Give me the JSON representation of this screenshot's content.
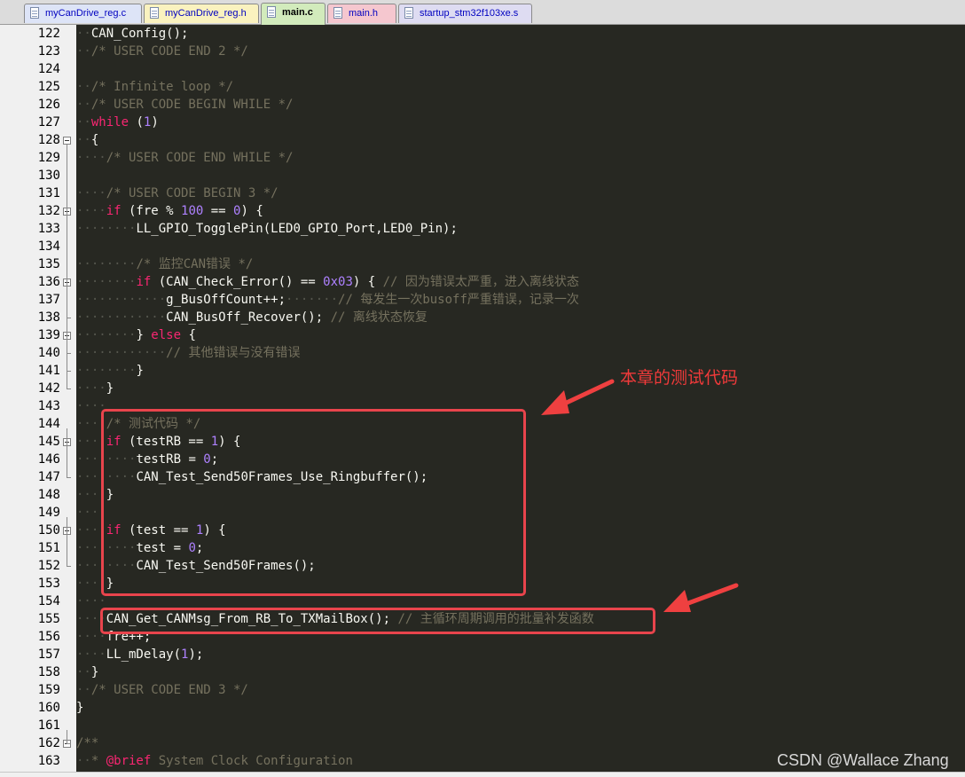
{
  "tabs": [
    {
      "label": "myCanDrive_reg.c",
      "color": "#dde4f7",
      "active": false
    },
    {
      "label": "myCanDrive_reg.h",
      "color": "#faf2bf",
      "active": false
    },
    {
      "label": "main.c",
      "color": "#d2ebbc",
      "active": true
    },
    {
      "label": "main.h",
      "color": "#f5c7cf",
      "active": false
    },
    {
      "label": "startup_stm32f103xe.s",
      "color": "#dedcf2",
      "active": false
    }
  ],
  "editor": {
    "theme_colors": {
      "background": "#272822",
      "keyword": "#f92672",
      "number": "#ae81ff",
      "comment": "#75715e",
      "text": "#f8f8f2",
      "annotation": "#e8444c"
    },
    "lines": [
      {
        "num": "122",
        "fold": "",
        "tokens": [
          {
            "i": "··"
          },
          {
            "t": "CAN_Config();",
            "c": "tx"
          }
        ]
      },
      {
        "num": "123",
        "fold": "",
        "tokens": [
          {
            "i": "··"
          },
          {
            "t": "/* USER CODE END 2 */",
            "c": "cm"
          }
        ]
      },
      {
        "num": "124",
        "fold": "",
        "tokens": []
      },
      {
        "num": "125",
        "fold": "",
        "tokens": [
          {
            "i": "··"
          },
          {
            "t": "/* Infinite loop */",
            "c": "cm"
          }
        ]
      },
      {
        "num": "126",
        "fold": "",
        "tokens": [
          {
            "i": "··"
          },
          {
            "t": "/* USER CODE BEGIN WHILE */",
            "c": "cm"
          }
        ]
      },
      {
        "num": "127",
        "fold": "",
        "tokens": [
          {
            "i": "··"
          },
          {
            "t": "while",
            "c": "kw"
          },
          {
            "t": " (",
            "c": "tx"
          },
          {
            "t": "1",
            "c": "nm"
          },
          {
            "t": ")",
            "c": "tx"
          }
        ]
      },
      {
        "num": "128",
        "fold": "open",
        "tokens": [
          {
            "i": "··"
          },
          {
            "t": "{",
            "c": "tx"
          }
        ]
      },
      {
        "num": "129",
        "fold": "",
        "tokens": [
          {
            "i": "····"
          },
          {
            "t": "/* USER CODE END WHILE */",
            "c": "cm"
          }
        ]
      },
      {
        "num": "130",
        "fold": "",
        "tokens": []
      },
      {
        "num": "131",
        "fold": "",
        "tokens": [
          {
            "i": "····"
          },
          {
            "t": "/* USER CODE BEGIN 3 */",
            "c": "cm"
          }
        ]
      },
      {
        "num": "132",
        "fold": "open",
        "tokens": [
          {
            "i": "····"
          },
          {
            "t": "if",
            "c": "kw"
          },
          {
            "t": " (fre % ",
            "c": "tx"
          },
          {
            "t": "100",
            "c": "nm"
          },
          {
            "t": " == ",
            "c": "tx"
          },
          {
            "t": "0",
            "c": "nm"
          },
          {
            "t": ") {",
            "c": "tx"
          }
        ]
      },
      {
        "num": "133",
        "fold": "",
        "tokens": [
          {
            "i": "········"
          },
          {
            "t": "LL_GPIO_TogglePin(LED0_GPIO_Port,LED0_Pin);",
            "c": "tx"
          }
        ]
      },
      {
        "num": "134",
        "fold": "",
        "tokens": []
      },
      {
        "num": "135",
        "fold": "",
        "tokens": [
          {
            "i": "········"
          },
          {
            "t": "/* 监控CAN错误 */",
            "c": "cm"
          }
        ]
      },
      {
        "num": "136",
        "fold": "open",
        "tokens": [
          {
            "i": "········"
          },
          {
            "t": "if",
            "c": "kw"
          },
          {
            "t": " (CAN_Check_Error() == ",
            "c": "tx"
          },
          {
            "t": "0x03",
            "c": "nm"
          },
          {
            "t": ") { ",
            "c": "tx"
          },
          {
            "t": "// 因为错误太严重，进入离线状态",
            "c": "cm"
          }
        ]
      },
      {
        "num": "137",
        "fold": "",
        "tokens": [
          {
            "i": "············"
          },
          {
            "t": "g_BusOffCount++;",
            "c": "tx"
          },
          {
            "i": "·······"
          },
          {
            "t": "// 每发生一次busoff严重错误，记录一次",
            "c": "cm"
          }
        ]
      },
      {
        "num": "138",
        "fold": "",
        "tokens": [
          {
            "i": "············"
          },
          {
            "t": "CAN_BusOff_Recover(); ",
            "c": "tx"
          },
          {
            "t": "// 离线状态恢复",
            "c": "cm"
          }
        ]
      },
      {
        "num": "139",
        "fold": "open",
        "tokens": [
          {
            "i": "········"
          },
          {
            "t": "} ",
            "c": "tx"
          },
          {
            "t": "else",
            "c": "kw"
          },
          {
            "t": " {",
            "c": "tx"
          }
        ]
      },
      {
        "num": "140",
        "fold": "",
        "tokens": [
          {
            "i": "············"
          },
          {
            "t": "// 其他错误与没有错误",
            "c": "cm"
          }
        ]
      },
      {
        "num": "141",
        "fold": "",
        "tokens": [
          {
            "i": "········"
          },
          {
            "t": "}",
            "c": "tx"
          }
        ]
      },
      {
        "num": "142",
        "fold": "",
        "tokens": [
          {
            "i": "····"
          },
          {
            "t": "}",
            "c": "tx"
          }
        ]
      },
      {
        "num": "143",
        "fold": "",
        "tokens": [
          {
            "i": "····"
          }
        ]
      },
      {
        "num": "144",
        "fold": "",
        "tokens": [
          {
            "i": "····"
          },
          {
            "t": "/* 测试代码 */",
            "c": "cm"
          }
        ]
      },
      {
        "num": "145",
        "fold": "open",
        "tokens": [
          {
            "i": "····"
          },
          {
            "t": "if",
            "c": "kw"
          },
          {
            "t": " (testRB == ",
            "c": "tx"
          },
          {
            "t": "1",
            "c": "nm"
          },
          {
            "t": ") {",
            "c": "tx"
          }
        ]
      },
      {
        "num": "146",
        "fold": "",
        "tokens": [
          {
            "i": "········"
          },
          {
            "t": "testRB = ",
            "c": "tx"
          },
          {
            "t": "0",
            "c": "nm"
          },
          {
            "t": ";",
            "c": "tx"
          }
        ]
      },
      {
        "num": "147",
        "fold": "",
        "tokens": [
          {
            "i": "········"
          },
          {
            "t": "CAN_Test_Send50Frames_Use_Ringbuffer();",
            "c": "tx"
          }
        ]
      },
      {
        "num": "148",
        "fold": "",
        "tokens": [
          {
            "i": "····"
          },
          {
            "t": "}",
            "c": "tx"
          }
        ]
      },
      {
        "num": "149",
        "fold": "",
        "tokens": [
          {
            "i": "····"
          }
        ]
      },
      {
        "num": "150",
        "fold": "open",
        "tokens": [
          {
            "i": "····"
          },
          {
            "t": "if",
            "c": "kw"
          },
          {
            "t": " (test == ",
            "c": "tx"
          },
          {
            "t": "1",
            "c": "nm"
          },
          {
            "t": ") {",
            "c": "tx"
          }
        ]
      },
      {
        "num": "151",
        "fold": "",
        "tokens": [
          {
            "i": "········"
          },
          {
            "t": "test = ",
            "c": "tx"
          },
          {
            "t": "0",
            "c": "nm"
          },
          {
            "t": ";",
            "c": "tx"
          }
        ]
      },
      {
        "num": "152",
        "fold": "",
        "tokens": [
          {
            "i": "········"
          },
          {
            "t": "CAN_Test_Send50Frames();",
            "c": "tx"
          }
        ]
      },
      {
        "num": "153",
        "fold": "",
        "tokens": [
          {
            "i": "····"
          },
          {
            "t": "}",
            "c": "tx"
          }
        ]
      },
      {
        "num": "154",
        "fold": "",
        "tokens": [
          {
            "i": "····"
          }
        ]
      },
      {
        "num": "155",
        "fold": "",
        "tokens": [
          {
            "i": "····"
          },
          {
            "t": "CAN_Get_CANMsg_From_RB_To_TXMailBox(); ",
            "c": "tx"
          },
          {
            "t": "// 主循环周期调用的批量补发函数",
            "c": "cm"
          }
        ]
      },
      {
        "num": "156",
        "fold": "",
        "tokens": [
          {
            "i": "····"
          },
          {
            "t": "fre++;",
            "c": "tx"
          }
        ]
      },
      {
        "num": "157",
        "fold": "",
        "tokens": [
          {
            "i": "····"
          },
          {
            "t": "LL_mDelay(",
            "c": "tx"
          },
          {
            "t": "1",
            "c": "nm"
          },
          {
            "t": ");",
            "c": "tx"
          }
        ]
      },
      {
        "num": "158",
        "fold": "",
        "tokens": [
          {
            "i": "··"
          },
          {
            "t": "}",
            "c": "tx"
          }
        ]
      },
      {
        "num": "159",
        "fold": "",
        "tokens": [
          {
            "i": "··"
          },
          {
            "t": "/* USER CODE END 3 */",
            "c": "cm"
          }
        ]
      },
      {
        "num": "160",
        "fold": "",
        "tokens": [
          {
            "t": "}",
            "c": "tx"
          }
        ]
      },
      {
        "num": "161",
        "fold": "",
        "tokens": []
      },
      {
        "num": "162",
        "fold": "open",
        "tokens": [
          {
            "t": "/**",
            "c": "cm"
          }
        ]
      },
      {
        "num": "163",
        "fold": "",
        "tokens": [
          {
            "i": "··"
          },
          {
            "t": "* ",
            "c": "cm"
          },
          {
            "t": "@brief",
            "c": "kw"
          },
          {
            "t": " System Clock Configuration",
            "c": "cm"
          }
        ]
      }
    ]
  },
  "annotation": {
    "label": "本章的测试代码"
  },
  "watermark": "CSDN @Wallace Zhang"
}
